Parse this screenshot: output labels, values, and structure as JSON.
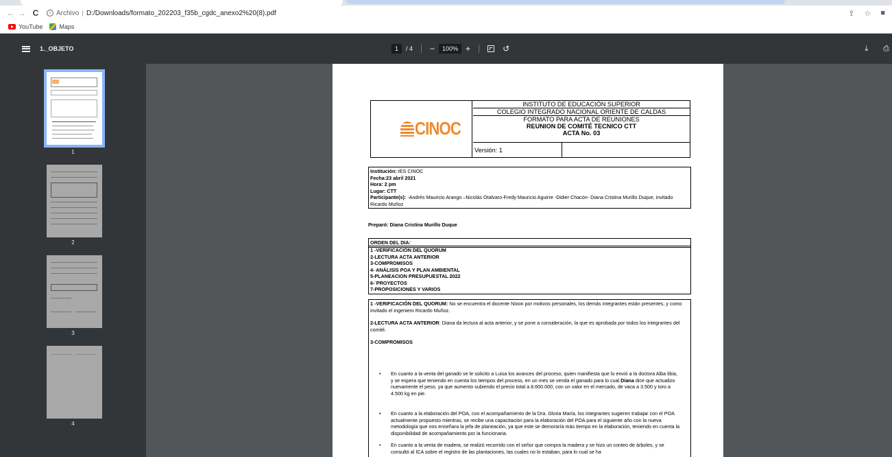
{
  "browser": {
    "url_scheme": "Archivo",
    "url_path": "D:/Downloads/formato_202203_f35b_cgdc_anexo2%20(8).pdf",
    "bookmarks": [
      {
        "label": "YouTube",
        "icon": "youtube-icon"
      },
      {
        "label": "Maps",
        "icon": "maps-icon"
      }
    ]
  },
  "pdf_toolbar": {
    "title": "1._OBJETO",
    "current_page": "1",
    "total_pages": "/ 4",
    "zoom": "100%"
  },
  "thumbnails": [
    {
      "num": "1",
      "selected": true
    },
    {
      "num": "2",
      "selected": false
    },
    {
      "num": "3",
      "selected": false
    },
    {
      "num": "4",
      "selected": false
    }
  ],
  "document": {
    "logo_text": "CINOC",
    "header_lines": [
      "INSTITUTO DE EDUCACIÓN SUPERIOR",
      "COLEGIO INTEGRADO NACIONAL ORIENTE DE CALDAS",
      "FORMATO PARA ACTA DE REUNIONES",
      "REUNION DE COMITÉ TECNICO CTT",
      "ACTA No. 03"
    ],
    "version": "Versión: 1",
    "meta": {
      "institucion_label": "Institución:",
      "institucion": "IES CINOC",
      "fecha": "Fecha:23 abril 2021",
      "hora": "Hora: 2 pm",
      "lugar": "Lugar: CTT",
      "participantes_label": "Participante(s):",
      "participantes": "-Andrés Mauricio Arango –Nicolás Otalvaro-Fredy Mauricio Aguirre -Didier Chacón- Diana Cristina Murillo Duque, invitado Ricardo Muñoz"
    },
    "preparo": "Preparó: Diana Cristina Murillo Duque",
    "orden_title": "ORDEN DEL DIA:",
    "orden_items": [
      "1 -VERIFICACIÓN DEL QUORUM",
      "2-LECTURA ACTA ANTERIOR",
      "3-COMPROMISOS",
      "4- ANÁLISIS POA Y PLAN AMBIENTAL",
      "5-PLANEACION PRESUPUESTAL 2022",
      "6-¨PROYECTOS",
      "7-PROPOSICIONES Y VARIOS"
    ],
    "s1_label": "1 -VERIFICACIÓN DEL QUORUM:",
    "s1_text": " No se encuentra el docente Nixon por motivos personales, los demás integrantes están presentes, y como invitado el ingeniero Ricardo Muñoz.",
    "s2_label": "2-LECTURA ACTA ANTERIOR",
    "s2_text": ": Diana da lectura al acta anterior, y se pone a consideración, la que es aprobada por todos los integrantes del comité.",
    "s3_label": "3-COMPROMISOS",
    "bullets": [
      {
        "pre": "En cuanto a la venta del ganado se le solicito a Luisa los avances del proceso, quien manifiesta que lo envió a la doctora Alba libia, y se espera que teniendo en cuenta los tiempos del proceso, en un mes se venda el ganado para lo cual ",
        "bold": "Diana",
        "post": " dice que actualizo nuevamente el peso, ya que aumento subiendo el precio total a 8.600.000, con un valor en el mercado, de vaca a 3.500 y toro a 4.500 kg en pie."
      },
      {
        "pre": "En cuanto a la elaboración del POA, con el acompañamiento de la Dra. Gloria María, los integrantes sugieren trabajar con el POA actualmente propuesto mientras, se recibe una capacitación para la elaboración del POA para el siguiente año con la nueva metodología que nos enseñara la jefa de planeación, ya que este se demoraría más tiempo en la elaboración, teniendo en cuenta la disponibilidad de acompañamiento por la funcionaria.",
        "bold": "",
        "post": ""
      },
      {
        "pre": "En cuanto a la venta de madera, se realizó recorrido con el señor que compra la madera y se hizo un conteo de árboles, y se consultó al ICA sobre el registro de las plantaciones, las cuales no lo estaban, para lo cual se ha",
        "bold": "",
        "post": ""
      }
    ]
  }
}
